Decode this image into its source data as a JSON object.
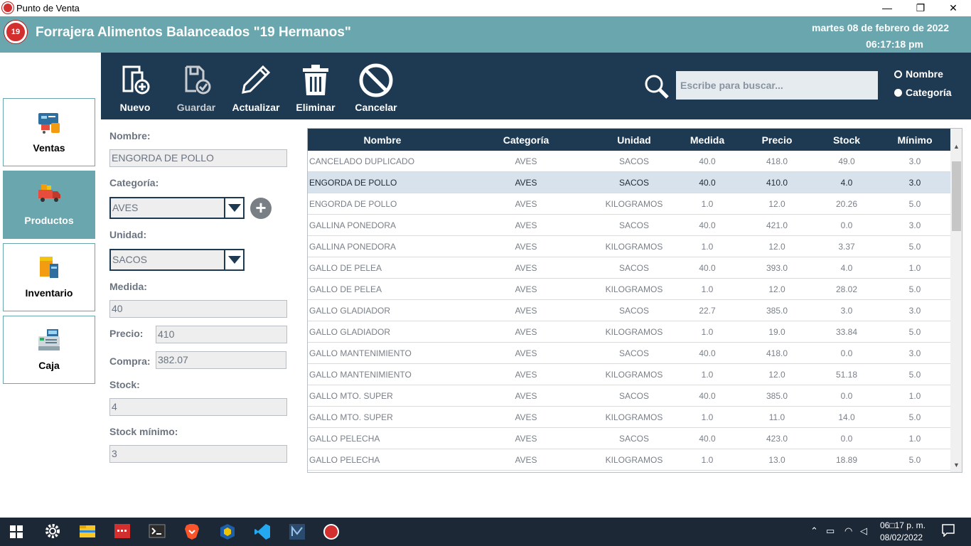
{
  "window": {
    "title": "Punto de Venta",
    "minimize": "—",
    "maximize": "❐",
    "close": "✕"
  },
  "header": {
    "logo_text": "19",
    "company": "Forrajera Alimentos Balanceados \"19 Hermanos\"",
    "date": "martes 08 de febrero de 2022",
    "time": "06:17:18 pm"
  },
  "toolbar": {
    "nuevo": "Nuevo",
    "guardar": "Guardar",
    "actualizar": "Actualizar",
    "eliminar": "Eliminar",
    "cancelar": "Cancelar",
    "search_placeholder": "Escribe para buscar...",
    "radio_nombre": "Nombre",
    "radio_categoria": "Categoría",
    "selected_radio": "Categoría"
  },
  "sidebar": {
    "items": [
      {
        "label": "Ventas",
        "icon": "cart-icon"
      },
      {
        "label": "Productos",
        "icon": "truck-icon"
      },
      {
        "label": "Inventario",
        "icon": "boxes-icon"
      },
      {
        "label": "Caja",
        "icon": "register-icon"
      }
    ],
    "active": "Productos"
  },
  "form": {
    "nombre_label": "Nombre:",
    "nombre_value": "ENGORDA DE POLLO",
    "categoria_label": "Categoría:",
    "categoria_value": "AVES",
    "unidad_label": "Unidad:",
    "unidad_value": "SACOS",
    "medida_label": "Medida:",
    "medida_value": "40",
    "precio_label": "Precio:",
    "precio_value": "410",
    "compra_label": "Compra:",
    "compra_value": "382.07",
    "stock_label": "Stock:",
    "stock_value": "4",
    "stock_min_label": "Stock mínimo:",
    "stock_min_value": "3",
    "add_symbol": "+"
  },
  "table": {
    "columns": [
      "Nombre",
      "Categoría",
      "Unidad",
      "Medida",
      "Precio",
      "Stock",
      "Mínimo"
    ],
    "selected_row": 1,
    "rows": [
      [
        "CANCELADO DUPLICADO",
        "AVES",
        "SACOS",
        "40.0",
        "418.0",
        "49.0",
        "3.0"
      ],
      [
        "ENGORDA DE POLLO",
        "AVES",
        "SACOS",
        "40.0",
        "410.0",
        "4.0",
        "3.0"
      ],
      [
        "ENGORDA DE POLLO",
        "AVES",
        "KILOGRAMOS",
        "1.0",
        "12.0",
        "20.26",
        "5.0"
      ],
      [
        "GALLINA PONEDORA",
        "AVES",
        "SACOS",
        "40.0",
        "421.0",
        "0.0",
        "3.0"
      ],
      [
        "GALLINA PONEDORA",
        "AVES",
        "KILOGRAMOS",
        "1.0",
        "12.0",
        "3.37",
        "5.0"
      ],
      [
        "GALLO DE PELEA",
        "AVES",
        "SACOS",
        "40.0",
        "393.0",
        "4.0",
        "1.0"
      ],
      [
        "GALLO DE PELEA",
        "AVES",
        "KILOGRAMOS",
        "1.0",
        "12.0",
        "28.02",
        "5.0"
      ],
      [
        "GALLO GLADIADOR",
        "AVES",
        "SACOS",
        "22.7",
        "385.0",
        "3.0",
        "3.0"
      ],
      [
        "GALLO GLADIADOR",
        "AVES",
        "KILOGRAMOS",
        "1.0",
        "19.0",
        "33.84",
        "5.0"
      ],
      [
        "GALLO MANTENIMIENTO",
        "AVES",
        "SACOS",
        "40.0",
        "418.0",
        "0.0",
        "3.0"
      ],
      [
        "GALLO MANTENIMIENTO",
        "AVES",
        "KILOGRAMOS",
        "1.0",
        "12.0",
        "51.18",
        "5.0"
      ],
      [
        "GALLO MTO. SUPER",
        "AVES",
        "SACOS",
        "40.0",
        "385.0",
        "0.0",
        "1.0"
      ],
      [
        "GALLO MTO. SUPER",
        "AVES",
        "KILOGRAMOS",
        "1.0",
        "11.0",
        "14.0",
        "5.0"
      ],
      [
        "GALLO PELECHA",
        "AVES",
        "SACOS",
        "40.0",
        "423.0",
        "0.0",
        "1.0"
      ],
      [
        "GALLO PELECHA",
        "AVES",
        "KILOGRAMOS",
        "1.0",
        "13.0",
        "18.89",
        "5.0"
      ]
    ]
  },
  "taskbar": {
    "time": "06□17 p. m.",
    "date": "08/02/2022"
  },
  "colors": {
    "header": "#6aa6ae",
    "toolbar": "#1e3a52",
    "taskbar": "#1c2836"
  }
}
